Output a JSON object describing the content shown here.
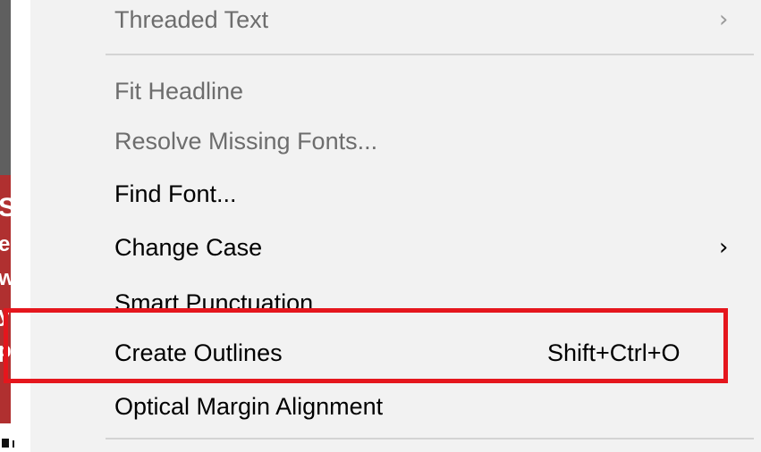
{
  "background": {
    "chars": [
      "S",
      "e",
      "w",
      "y",
      "p"
    ]
  },
  "menu": {
    "items": [
      {
        "label": "Threaded Text",
        "enabled": false,
        "submenu_glyph": "›"
      },
      {
        "label": "Fit Headline",
        "enabled": false
      },
      {
        "label": "Resolve Missing Fonts...",
        "enabled": false
      },
      {
        "label": "Find Font...",
        "enabled": true
      },
      {
        "label": "Change Case",
        "enabled": true,
        "submenu_glyph": "›"
      },
      {
        "label": "Smart Punctuation...",
        "enabled": true
      },
      {
        "label": "Create Outlines",
        "enabled": true,
        "shortcut": "Shift+Ctrl+O"
      },
      {
        "label": "Optical Margin Alignment",
        "enabled": true
      }
    ]
  },
  "colors": {
    "highlight_box": "#e5161d",
    "disabled_text": "#6d6d6d",
    "menu_background": "#f2f2f2",
    "background_red": "#b03030",
    "background_dark": "#5f5f5f"
  }
}
